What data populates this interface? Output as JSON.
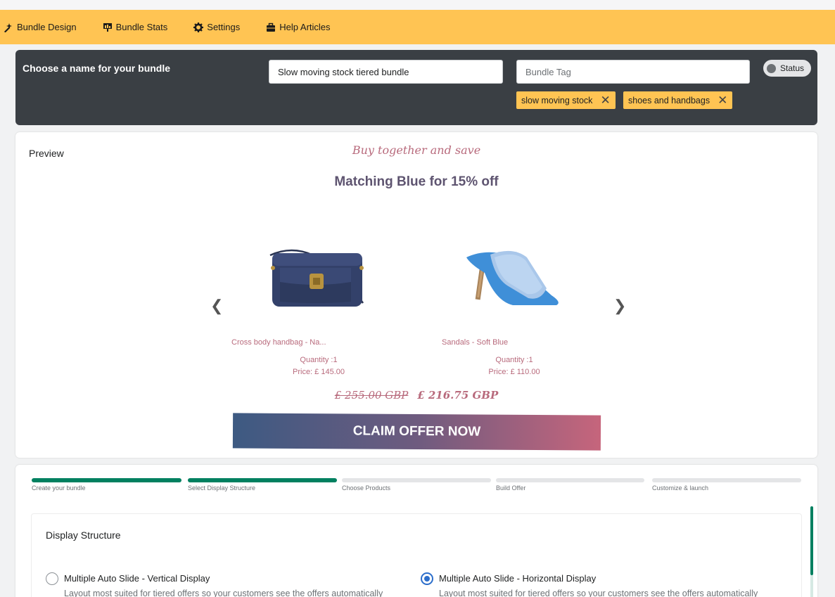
{
  "nav": {
    "items": [
      {
        "label": "Bundle Design",
        "icon": "wand-icon"
      },
      {
        "label": "Bundle Stats",
        "icon": "chart-icon"
      },
      {
        "label": "Settings",
        "icon": "gear-icon"
      },
      {
        "label": "Help Articles",
        "icon": "briefcase-icon"
      }
    ]
  },
  "name_section": {
    "label": "Choose a name for your bundle",
    "name_value": "Slow moving stock tiered bundle",
    "tag_placeholder": "Bundle Tag",
    "status_label": "Status",
    "tags": [
      "slow moving stock",
      "shoes and handbags"
    ]
  },
  "preview": {
    "label": "Preview",
    "tagline": "Buy together and save",
    "headline": "Matching Blue for 15% off",
    "products": [
      {
        "name": "Cross body handbag - Na...",
        "quantity": "Quantity :1",
        "price": "Price: £ 145.00"
      },
      {
        "name": "Sandals - Soft Blue",
        "quantity": "Quantity :1",
        "price": "Price: £ 110.00"
      }
    ],
    "old_price": "£ 255.00 GBP",
    "new_price": "£ 216.75 GBP",
    "cta": "CLAIM OFFER NOW",
    "colors": {
      "accent_text": "#b86a7c",
      "headline": "#5e5470",
      "cta_from": "#3d5a82",
      "cta_to": "#c6657c"
    }
  },
  "steps": [
    {
      "label": "Create your bundle",
      "complete": true
    },
    {
      "label": "Select Display Structure",
      "complete": true
    },
    {
      "label": "Choose Products",
      "complete": false
    },
    {
      "label": "Build Offer",
      "complete": false
    },
    {
      "label": "Customize & launch",
      "complete": false
    }
  ],
  "display_structure": {
    "title": "Display Structure",
    "options": [
      {
        "label": "Multiple Auto Slide - Vertical Display",
        "description": "Layout most suited for tiered offers so your customers see the offers automatically",
        "selected": false
      },
      {
        "label": "Multiple Auto Slide - Horizontal Display",
        "description": "Layout most suited for tiered offers so your customers see the offers automatically",
        "selected": true
      }
    ]
  }
}
